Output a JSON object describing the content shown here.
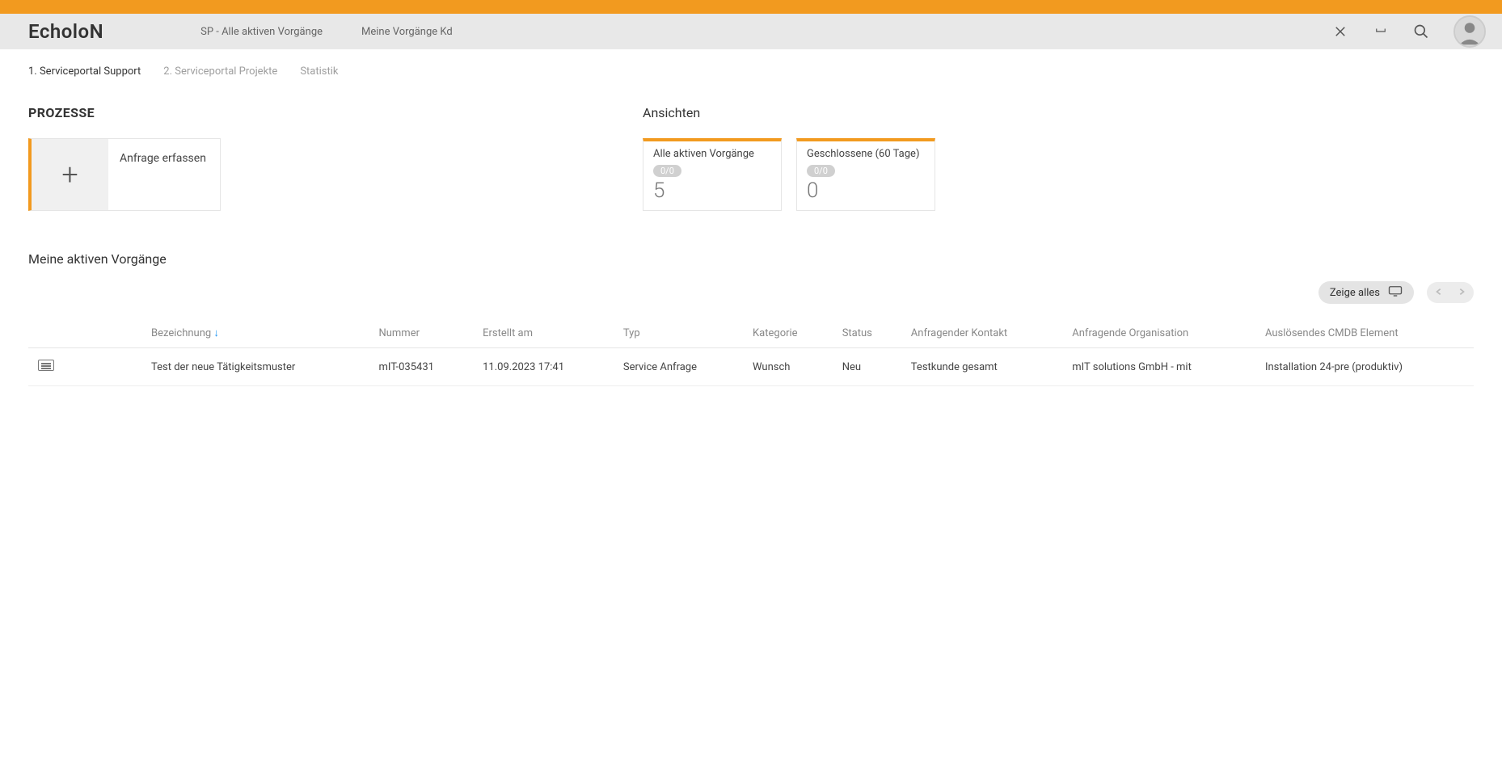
{
  "header": {
    "logo": "EcholoN",
    "nav": [
      "SP - Alle aktiven Vorgänge",
      "Meine Vorgänge Kd"
    ]
  },
  "tabs": [
    "1. Serviceportal Support",
    "2. Serviceportal Projekte",
    "Statistik"
  ],
  "active_tab_index": 0,
  "processes": {
    "title": "PROZESSE",
    "card_label": "Anfrage erfassen"
  },
  "views": {
    "title": "Ansichten",
    "cards": [
      {
        "title": "Alle aktiven Vorgänge",
        "badge": "0/0",
        "count": "5"
      },
      {
        "title": "Geschlossene (60 Tage)",
        "badge": "0/0",
        "count": "0"
      }
    ]
  },
  "list": {
    "title": "Meine aktiven Vorgänge",
    "show_all": "Zeige alles",
    "columns": [
      "",
      "Bezeichnung",
      "Nummer",
      "Erstellt am",
      "Typ",
      "Kategorie",
      "Status",
      "Anfragender Kontakt",
      "Anfragende Organisation",
      "Auslösendes CMDB Element"
    ],
    "rows": [
      {
        "bezeichnung": "Test der neue Tätigkeitsmuster",
        "nummer": "mIT-035431",
        "erstellt": "11.09.2023 17:41",
        "typ": "Service Anfrage",
        "kategorie": "Wunsch",
        "status": "Neu",
        "kontakt": "Testkunde gesamt",
        "org": "mIT solutions GmbH - mit",
        "cmdb": "Installation 24-pre (produktiv)"
      }
    ]
  }
}
